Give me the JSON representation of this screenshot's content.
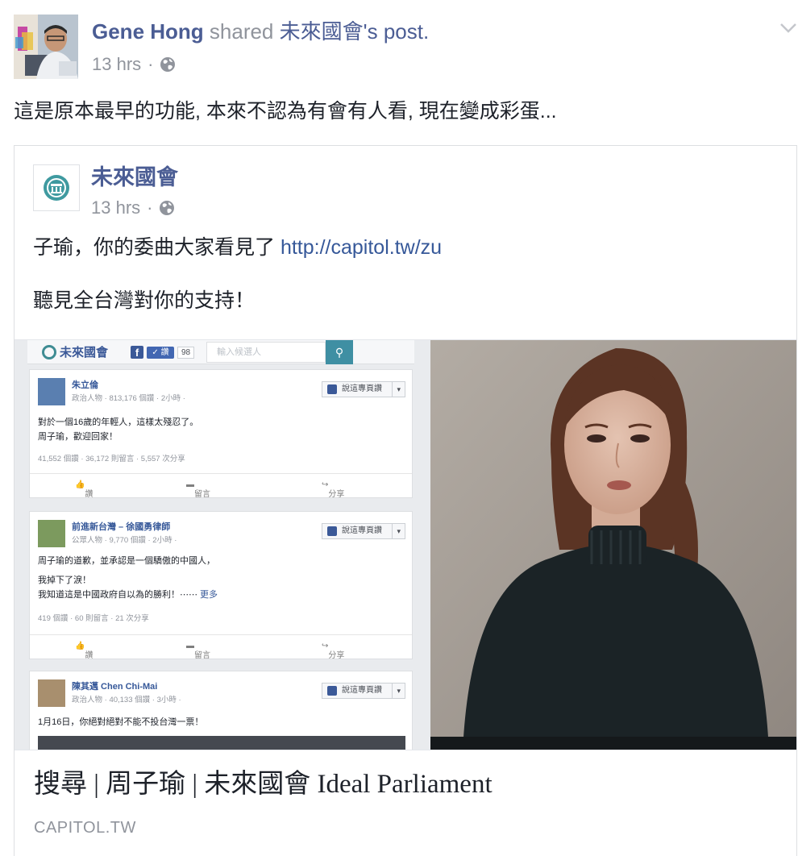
{
  "post": {
    "author": "Gene Hong",
    "shared_text": " shared ",
    "shared_page": "未來國會",
    "shared_suffix": "'s post.",
    "timestamp": "13 hrs",
    "separator": "·",
    "message": "這是原本最早的功能, 本來不認為有會有人看, 現在變成彩蛋..."
  },
  "shared": {
    "page_name": "未來國會",
    "timestamp": "13 hrs",
    "separator": "·",
    "line1_text": "子瑜，你的委曲大家看見了 ",
    "line1_link": "http://capitol.tw/zu",
    "line2_text": "聽見全台灣對你的支持！"
  },
  "preview": {
    "topbar": {
      "logo_text": "未來國會",
      "like_label": "讚",
      "like_count": "98",
      "search_placeholder": "輸入候選人"
    },
    "cards": [
      {
        "name": "朱立倫",
        "sub": "政治人物 · 813,176 個讚 · 2小時 ·",
        "follow": "說這專頁讚",
        "lines": [
          "對於一個16歲的年輕人，這樣太殘忍了。",
          "周子瑜，歡迎回家！"
        ],
        "more": "",
        "stats": "41,552 個讚 · 36,172 則留言 · 5,557 次分享",
        "actions": [
          "讚",
          "留言",
          "分享"
        ]
      },
      {
        "name": "前進新台灣 – 徐國勇律師",
        "sub": "公眾人物 · 9,770 個讚 · 2小時 ·",
        "follow": "說這專頁讚",
        "lines": [
          "周子瑜的道歉，並承認是一個驕傲的中國人，",
          "我掉下了淚！",
          "我知道這是中國政府自以為的勝利！⋯⋯"
        ],
        "more": " 更多",
        "stats": "419 個讚 · 60 則留言 · 21 次分享",
        "actions": [
          "讚",
          "留言",
          "分享"
        ]
      },
      {
        "name": "陳其邁 Chen Chi-Mai",
        "sub": "政治人物 · 40,133 個讚 · 3小時 ·",
        "follow": "說這專頁讚",
        "lines": [
          "1月16日，你絕對絕對不能不投台灣一票！"
        ],
        "more": "",
        "stats": "",
        "actions": []
      }
    ]
  },
  "link": {
    "title": "搜尋 | 周子瑜 | 未來國會 Ideal Parliament",
    "domain": "CAPITOL.TW"
  },
  "icons": {
    "globe": "globe-icon",
    "chevron": "chevron-down-icon",
    "page_logo": "capitol-logo-icon"
  },
  "colors": {
    "link_blue": "#4b5d94",
    "meta_gray": "#90949c",
    "text": "#1d2129"
  }
}
